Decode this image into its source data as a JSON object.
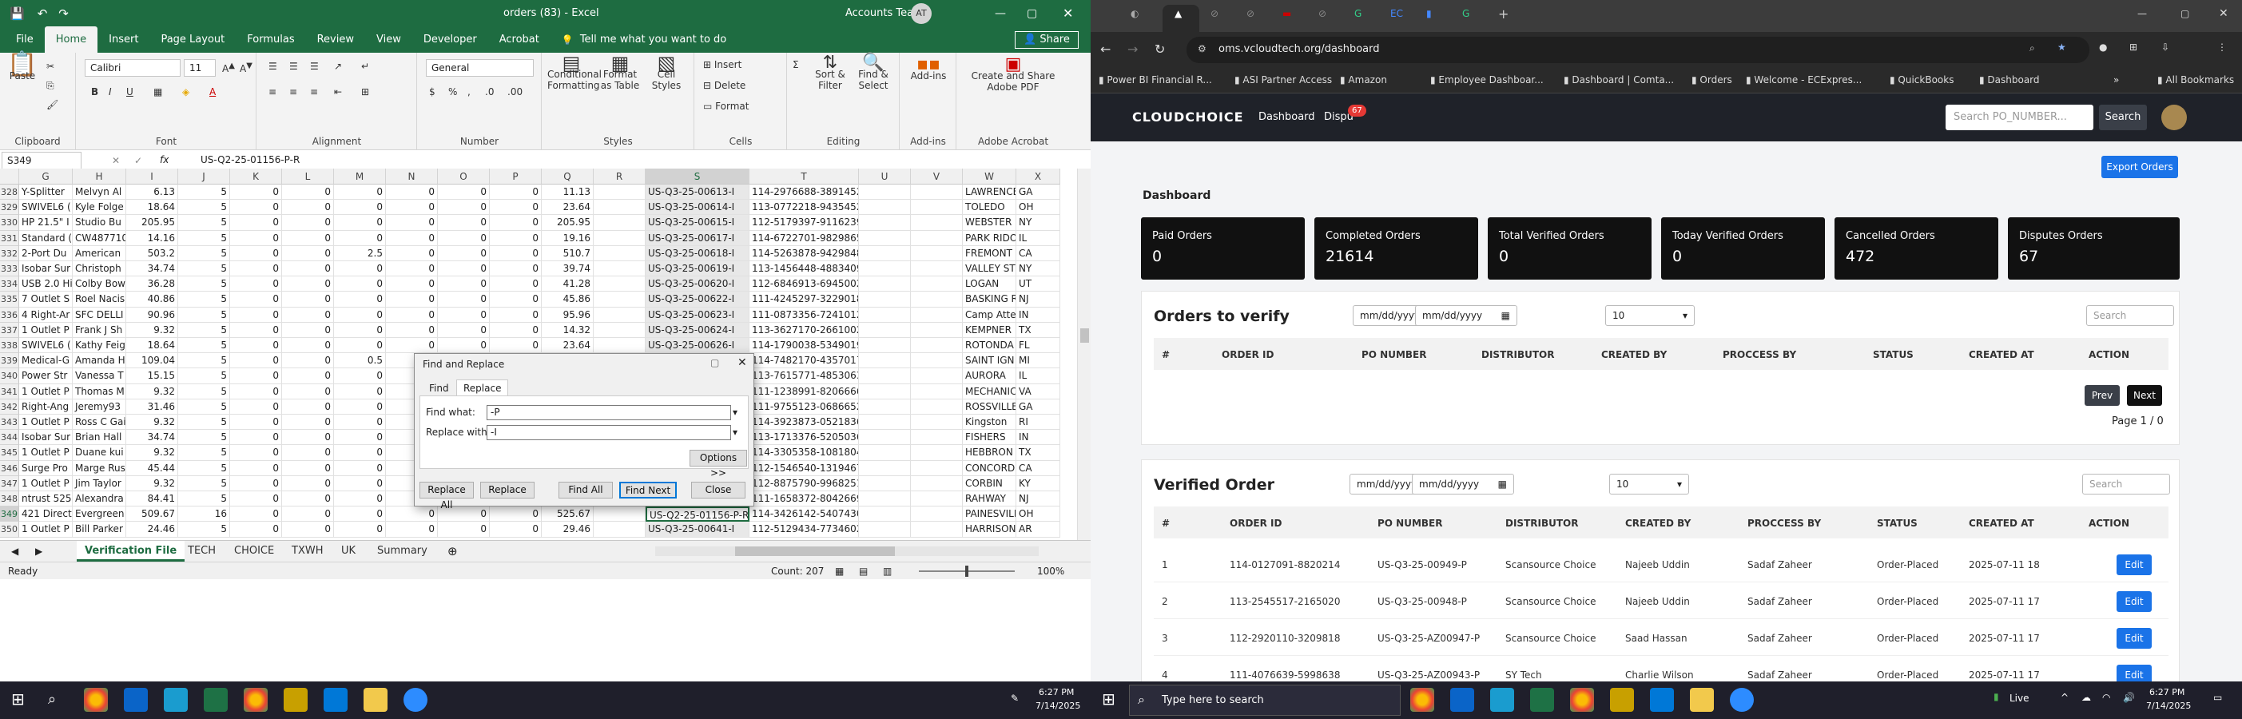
{
  "excel": {
    "title": "orders (83)  -  Excel",
    "account": "Accounts Team",
    "account_initials": "AT",
    "tabs": [
      "File",
      "Home",
      "Insert",
      "Page Layout",
      "Formulas",
      "Review",
      "View",
      "Developer",
      "Acrobat"
    ],
    "active_tab": "Home",
    "tell_me": "Tell me what you want to do",
    "share": "Share",
    "ribbon": {
      "paste": "Paste",
      "clipboard": "Clipboard",
      "font_name": "Calibri",
      "font_size": "11",
      "font": "Font",
      "alignment": "Alignment",
      "number_format": "General",
      "number": "Number",
      "conditional": "Conditional Formatting",
      "format_table": "Format as Table",
      "cell_styles": "Cell Styles",
      "styles": "Styles",
      "insert": "Insert",
      "delete": "Delete",
      "format": "Format",
      "cells": "Cells",
      "sort": "Sort & Filter",
      "find": "Find & Select",
      "editing": "Editing",
      "addins": "Add-ins",
      "addins_group": "Add-ins",
      "create_pdf": "Create and Share Adobe PDF",
      "acrobat_group": "Adobe Acrobat"
    },
    "name_box": "S349",
    "formula": "US-Q2-25-01156-P-R",
    "columns": [
      "G",
      "H",
      "I",
      "J",
      "K",
      "L",
      "M",
      "N",
      "O",
      "P",
      "Q",
      "R",
      "S",
      "T",
      "U",
      "V",
      "W",
      "X"
    ],
    "rows": [
      {
        "n": "328",
        "g": "Y-Splitter",
        "h": "Melvyn Al",
        "i": "6.13",
        "j": "5",
        "k": "0",
        "l": "0",
        "m": "0",
        "o": "0",
        "p": "0",
        "q": "11.13",
        "s": "US-Q3-25-00613-I",
        "t": "114-2976688-3891452",
        "w": "LAWRENCE",
        "x": "GA"
      },
      {
        "n": "329",
        "g": "SWIVEL6 (",
        "h": "Kyle Folge",
        "i": "18.64",
        "j": "5",
        "k": "0",
        "l": "0",
        "m": "0",
        "o": "0",
        "p": "0",
        "q": "23.64",
        "s": "US-Q3-25-00614-I",
        "t": "113-0772218-9435452",
        "w": "TOLEDO",
        "x": "OH"
      },
      {
        "n": "330",
        "g": "HP 21.5\" I",
        "h": "Studio Bu",
        "i": "205.95",
        "j": "5",
        "k": "0",
        "l": "0",
        "m": "0",
        "o": "0",
        "p": "0",
        "q": "205.95",
        "s": "US-Q3-25-00615-I",
        "t": "112-5179397-9116239",
        "w": "WEBSTER",
        "x": "NY"
      },
      {
        "n": "331",
        "g": "Standard (",
        "h": "CW487710",
        "i": "14.16",
        "j": "5",
        "k": "0",
        "l": "0",
        "m": "0",
        "o": "0",
        "p": "0",
        "q": "19.16",
        "s": "US-Q3-25-00617-I",
        "t": "114-6722701-9829865",
        "w": "PARK RIDO",
        "x": "IL"
      },
      {
        "n": "332",
        "g": "2-Port Du",
        "h": "American",
        "i": "503.2",
        "j": "5",
        "k": "0",
        "l": "0",
        "m": "2.5",
        "o": "0",
        "p": "0",
        "q": "510.7",
        "s": "US-Q3-25-00618-I",
        "t": "114-5263878-9429848",
        "w": "FREMONT",
        "x": "CA"
      },
      {
        "n": "333",
        "g": "Isobar Sur",
        "h": "Christoph",
        "i": "34.74",
        "j": "5",
        "k": "0",
        "l": "0",
        "m": "0",
        "o": "0",
        "p": "0",
        "q": "39.74",
        "s": "US-Q3-25-00619-I",
        "t": "113-1456448-4883409",
        "w": "VALLEY ST",
        "x": "NY"
      },
      {
        "n": "334",
        "g": "USB 2.0 Hi",
        "h": "Colby Bow",
        "i": "36.28",
        "j": "5",
        "k": "0",
        "l": "0",
        "m": "0",
        "o": "0",
        "p": "0",
        "q": "41.28",
        "s": "US-Q3-25-00620-I",
        "t": "112-6846913-6945002",
        "w": "LOGAN",
        "x": "UT"
      },
      {
        "n": "335",
        "g": "7 Outlet S",
        "h": "Roel Nacis",
        "i": "40.86",
        "j": "5",
        "k": "0",
        "l": "0",
        "m": "0",
        "o": "0",
        "p": "0",
        "q": "45.86",
        "s": "US-Q3-25-00622-I",
        "t": "111-4245297-3229018",
        "w": "BASKING R",
        "x": "NJ"
      },
      {
        "n": "336",
        "g": "4 Right-Ar",
        "h": "SFC DELLI",
        "i": "90.96",
        "j": "5",
        "k": "0",
        "l": "0",
        "m": "0",
        "o": "0",
        "p": "0",
        "q": "95.96",
        "s": "US-Q3-25-00623-I",
        "t": "111-0873356-7241012",
        "w": "Camp Atte",
        "x": "IN"
      },
      {
        "n": "337",
        "g": "1 Outlet P",
        "h": "Frank J Sh",
        "i": "9.32",
        "j": "5",
        "k": "0",
        "l": "0",
        "m": "0",
        "o": "0",
        "p": "0",
        "q": "14.32",
        "s": "US-Q3-25-00624-I",
        "t": "113-3627170-2661002",
        "w": "KEMPNER",
        "x": "TX"
      },
      {
        "n": "338",
        "g": "SWIVEL6 (",
        "h": "Kathy Feig",
        "i": "18.64",
        "j": "5",
        "k": "0",
        "l": "0",
        "m": "0",
        "o": "0",
        "p": "0",
        "q": "23.64",
        "s": "US-Q3-25-00626-I",
        "t": "114-1790038-5349019",
        "w": "ROTONDA",
        "x": "FL"
      },
      {
        "n": "339",
        "g": "Medical-G",
        "h": "Amanda H",
        "i": "109.04",
        "j": "5",
        "k": "0",
        "l": "0",
        "m": "0.5",
        "o": "",
        "p": "",
        "q": "",
        "s": "",
        "t": "114-7482170-4357017",
        "w": "SAINT IGN",
        "x": "MI"
      },
      {
        "n": "340",
        "g": "Power Str",
        "h": "Vanessa T",
        "i": "15.15",
        "j": "5",
        "k": "0",
        "l": "0",
        "m": "0",
        "o": "",
        "p": "",
        "q": "",
        "s": "",
        "t": "113-7615771-4853063",
        "w": "AURORA",
        "x": "IL"
      },
      {
        "n": "341",
        "g": "1 Outlet P",
        "h": "Thomas M",
        "i": "9.32",
        "j": "5",
        "k": "0",
        "l": "0",
        "m": "0",
        "o": "",
        "p": "",
        "q": "",
        "s": "",
        "t": "111-1238991-8206666",
        "w": "MECHANIC",
        "x": "VA"
      },
      {
        "n": "342",
        "g": "Right-Ang",
        "h": "Jeremy93",
        "i": "31.46",
        "j": "5",
        "k": "0",
        "l": "0",
        "m": "0",
        "o": "",
        "p": "",
        "q": "",
        "s": "",
        "t": "111-9755123-0686652",
        "w": "ROSSVILLE",
        "x": "GA"
      },
      {
        "n": "343",
        "g": "1 Outlet P",
        "h": "Ross C Gai",
        "i": "9.32",
        "j": "5",
        "k": "0",
        "l": "0",
        "m": "0",
        "o": "",
        "p": "",
        "q": "",
        "s": "",
        "t": "114-3923873-0521836",
        "w": "Kingston",
        "x": "RI"
      },
      {
        "n": "344",
        "g": "Isobar Sur",
        "h": "Brian Hall",
        "i": "34.74",
        "j": "5",
        "k": "0",
        "l": "0",
        "m": "0",
        "o": "",
        "p": "",
        "q": "",
        "s": "",
        "t": "113-1713376-5205036",
        "w": "FISHERS",
        "x": "IN"
      },
      {
        "n": "345",
        "g": "1 Outlet P",
        "h": "Duane kui",
        "i": "9.32",
        "j": "5",
        "k": "0",
        "l": "0",
        "m": "0",
        "o": "",
        "p": "",
        "q": "",
        "s": "",
        "t": "114-3305358-1081804",
        "w": "HEBBRON",
        "x": "TX"
      },
      {
        "n": "346",
        "g": "Surge Pro",
        "h": "Marge Rus",
        "i": "45.44",
        "j": "5",
        "k": "0",
        "l": "0",
        "m": "0",
        "o": "",
        "p": "",
        "q": "",
        "s": "",
        "t": "112-1546540-1319467",
        "w": "CONCORD",
        "x": "CA"
      },
      {
        "n": "347",
        "g": "1 Outlet P",
        "h": "Jim Taylor",
        "i": "9.32",
        "j": "5",
        "k": "0",
        "l": "0",
        "m": "0",
        "o": "",
        "p": "",
        "q": "",
        "s": "",
        "t": "112-8875790-9968251",
        "w": "CORBIN",
        "x": "KY"
      },
      {
        "n": "348",
        "g": "ntrust 525",
        "h": "Alexandra",
        "i": "84.41",
        "j": "5",
        "k": "0",
        "l": "0",
        "m": "0",
        "o": "0",
        "p": "0",
        "q": "89.41",
        "s": "US-Q3-25-00640-I",
        "t": "111-1658372-8042669",
        "w": "RAHWAY",
        "x": "NJ"
      },
      {
        "n": "349",
        "g": "421 Direct",
        "h": "Evergreen",
        "i": "509.67",
        "j": "16",
        "k": "0",
        "l": "0",
        "m": "0",
        "o": "0",
        "p": "0",
        "q": "525.67",
        "s": "US-Q2-25-01156-P-R",
        "t": "114-3426142-5407430",
        "w": "PAINESVILI",
        "x": "OH"
      },
      {
        "n": "350",
        "g": "1 Outlet P",
        "h": "Bill Parker",
        "i": "24.46",
        "j": "5",
        "k": "0",
        "l": "0",
        "m": "0",
        "o": "0",
        "p": "0",
        "q": "29.46",
        "s": "US-Q3-25-00641-I",
        "t": "112-5129434-7734602",
        "w": "HARRISON",
        "x": "AR"
      }
    ],
    "sheet_tabs": [
      "Verification File",
      "TECH",
      "CHOICE",
      "TXWH",
      "UK",
      "Summary"
    ],
    "status_ready": "Ready",
    "status_count": "Count: 207",
    "zoom": "100%",
    "dialog": {
      "title": "Find and Replace",
      "tab_find": "Find",
      "tab_replace": "Replace",
      "find_label": "Find what:",
      "find_value": "-P",
      "replace_label": "Replace with:",
      "replace_value": "-I",
      "options": "Options >>",
      "replace_all": "Replace All",
      "replace": "Replace",
      "find_all": "Find All",
      "find_next": "Find Next",
      "close": "Close"
    }
  },
  "taskbar_left": {
    "search_placeholder": "Type here to search",
    "time": "6:27 PM",
    "date": "7/14/2025"
  },
  "browser": {
    "url": "oms.vcloudtech.org/dashboard",
    "bookmarks": [
      "Power BI Financial R...",
      "ASI Partner Access",
      "Amazon",
      "Employee Dashboar...",
      "Dashboard | Comta...",
      "Orders",
      "Welcome - ECExpres...",
      "QuickBooks",
      "Dashboard",
      "All Bookmarks"
    ],
    "app": {
      "logo": "CLOUDCHOICE",
      "nav": [
        "Dashboard",
        "Dispu"
      ],
      "nav_badge": "67",
      "search_placeholder": "Search PO_NUMBER...",
      "search_button": "Search",
      "export": "Export Orders",
      "heading": "Dashboard",
      "cards": [
        {
          "label": "Paid Orders",
          "value": "0"
        },
        {
          "label": "Completed Orders",
          "value": "21614"
        },
        {
          "label": "Total Verified Orders",
          "value": "0"
        },
        {
          "label": "Today Verified Orders",
          "value": "0"
        },
        {
          "label": "Cancelled Orders",
          "value": "472"
        },
        {
          "label": "Disputes Orders",
          "value": "67"
        }
      ],
      "verify": {
        "title": "Orders to verify",
        "date_placeholder": "mm/dd/yyyy",
        "page_size": "10",
        "search_placeholder": "Search",
        "columns": [
          "#",
          "ORDER ID",
          "PO NUMBER",
          "DISTRIBUTOR",
          "CREATED BY",
          "PROCCESS BY",
          "STATUS",
          "CREATED AT",
          "ACTION"
        ],
        "prev": "Prev",
        "next": "Next",
        "page_info": "Page 1 / 0"
      },
      "verified": {
        "title": "Verified Order",
        "columns": [
          "#",
          "ORDER ID",
          "PO NUMBER",
          "DISTRIBUTOR",
          "CREATED BY",
          "PROCCESS BY",
          "STATUS",
          "CREATED AT",
          "ACTION"
        ],
        "edit": "Edit",
        "rows": [
          {
            "n": "1",
            "order": "114-0127091-8820214",
            "po": "US-Q3-25-00949-P",
            "dist": "Scansource Choice",
            "by": "Najeeb Uddin",
            "proc": "Sadaf Zaheer",
            "status": "Order-Placed",
            "at": "2025-07-11 18"
          },
          {
            "n": "2",
            "order": "113-2545517-2165020",
            "po": "US-Q3-25-00948-P",
            "dist": "Scansource Choice",
            "by": "Najeeb Uddin",
            "proc": "Sadaf Zaheer",
            "status": "Order-Placed",
            "at": "2025-07-11 17"
          },
          {
            "n": "3",
            "order": "112-2920110-3209818",
            "po": "US-Q3-25-AZ00947-P",
            "dist": "Scansource Choice",
            "by": "Saad Hassan",
            "proc": "Sadaf Zaheer",
            "status": "Order-Placed",
            "at": "2025-07-11 17"
          },
          {
            "n": "4",
            "order": "111-4076639-5998638",
            "po": "US-Q3-25-AZ00943-P",
            "dist": "SY Tech",
            "by": "Charlie Wilson",
            "proc": "Sadaf Zaheer",
            "status": "Order-Placed",
            "at": "2025-07-11 17"
          }
        ]
      }
    }
  },
  "taskbar_right": {
    "search_placeholder": "Type here to search",
    "weather": "Live",
    "time": "6:27 PM",
    "date": "7/14/2025"
  }
}
